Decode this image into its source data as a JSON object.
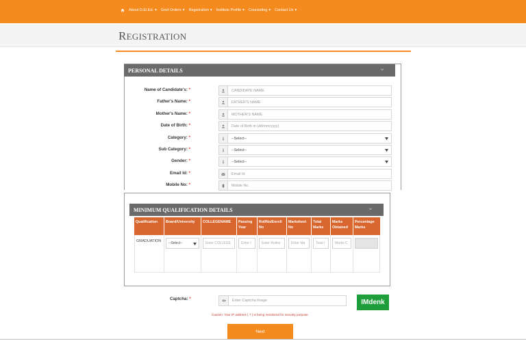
{
  "nav": {
    "items": [
      {
        "label": "About D.El.Ed."
      },
      {
        "label": "Govt Orders"
      },
      {
        "label": "Registration"
      },
      {
        "label": "Institute Profile"
      },
      {
        "label": "Counseling"
      },
      {
        "label": "Contact Us"
      }
    ],
    "dropdown_glyph": "▾"
  },
  "page": {
    "title_first": "R",
    "title_rest": "EGISTRATION"
  },
  "personal": {
    "header": "PERSONAL DETAILS",
    "required_mark": "*",
    "fields": [
      {
        "label": "Name of Candidate's:",
        "icon": "user-icon",
        "placeholder": "CANDIDATE NAME"
      },
      {
        "label": "Father's Name:",
        "icon": "user-icon",
        "placeholder": "FATHER'S NAME"
      },
      {
        "label": "Mother's Name:",
        "icon": "user-icon",
        "placeholder": "MOTHER'S NAME"
      },
      {
        "label": "Date of Birth:",
        "icon": "user-icon",
        "placeholder": "Date of Birth in (dd/mm/yyyy)"
      },
      {
        "label": "Category:",
        "icon": "info-icon",
        "value": "--Select--"
      },
      {
        "label": "Sub Category:",
        "icon": "info-icon",
        "value": "--Select--"
      },
      {
        "label": "Gender:",
        "icon": "info-icon",
        "value": "--Select--"
      },
      {
        "label": "Email Id:",
        "icon": "envelope-icon",
        "placeholder": "Email Id"
      },
      {
        "label": "Mobile No:",
        "icon": "phone-icon",
        "placeholder": "Mobile No."
      }
    ]
  },
  "qualification": {
    "header": "MINIMUM QUALIFICATION DETAILS",
    "columns": [
      "Qualification",
      "Board/University",
      "COLLEGENAME",
      "Passing Year",
      "RollNo/Enroll No",
      "Marksheet No",
      "Total Marks",
      "Marks Obtained",
      "Percentage Marks"
    ],
    "row": {
      "qualification": "GRADUATION",
      "board": "--Select--",
      "college_placeholder": "Enter COLLEGE",
      "year_placeholder": "Enter I",
      "roll_placeholder": "Enter Rollno",
      "marksheet_placeholder": "Enter Ma",
      "total_placeholder": "Total I",
      "obtained_placeholder": "Marks C",
      "percentage": ""
    }
  },
  "captcha": {
    "label": "Captcha:",
    "placeholder": "Enter Captcha Image",
    "image_text": "IMdenk",
    "caution": "Caution: Your IP address ( ? ) is being monitored for security purpose."
  },
  "actions": {
    "next_label": "Next"
  },
  "colors": {
    "brand_orange": "#f58a1f",
    "header_grey": "#6a6a6a",
    "table_header": "#d9662e",
    "captcha_green": "#1e9e3a"
  }
}
